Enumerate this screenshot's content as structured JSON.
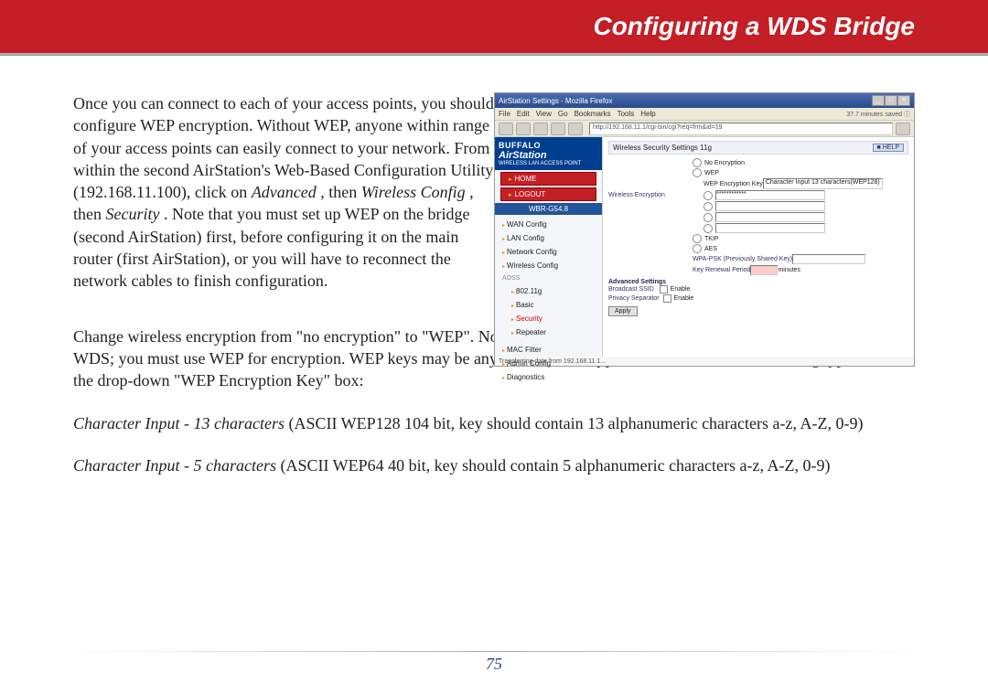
{
  "header": {
    "title": "Configuring a WDS Bridge"
  },
  "body": {
    "p1": "Once you can connect to each of your access points, you should configure WEP encryption. Without WEP, anyone within range of your access points can easily connect to your network.  From within the second AirStation's Web-Based Configuration Utility (192.168.11.100), click on ",
    "p1_i1": "Advanced",
    "p1_a": ", then ",
    "p1_i2": "Wireless Config",
    "p1_b": ", then ",
    "p1_i3": "Security",
    "p1_c": ".  Note that you must set up WEP on the bridge (second AirStation) first, before configuring it on the main router (first AirStation), or you will have to reconnect the network cables to finish configuration.",
    "p2": "Change wireless encryption from \"no encryption\" to \"WEP\".  Note that TKIP and AES encryption schemes will not work with WDS; you must use WEP for encryption.  WEP keys may be any of 4 different types; choose one of the following types from the drop-down \"WEP Encryption Key\" box:",
    "p3_i": "Character Input - 13 characters",
    "p3_r": " (ASCII WEP128 104 bit, key should contain 13 alphanumeric characters a-z, A-Z, 0-9)",
    "p4_i": "Character Input - 5 characters",
    "p4_r": " (ASCII WEP64 40 bit, key should contain 5 alphanumeric characters a-z, A-Z, 0-9)"
  },
  "screenshot": {
    "window_title": "AirStation Settings - Mozilla Firefox",
    "saved": "37.7 minutes saved",
    "menu": [
      "File",
      "Edit",
      "View",
      "Go",
      "Bookmarks",
      "Tools",
      "Help"
    ],
    "url": "http://192.168.11.1/cgi-bin/cgi?req=frm&id=19",
    "logo_top": "BUFFALO",
    "logo_main": "AirStation",
    "logo_sub": "WIRELESS LAN ACCESS POINT",
    "btn_home": "HOME",
    "btn_logout": "LOGOUT",
    "model": "WBR-G54.8",
    "nav": {
      "items": [
        "WAN Config",
        "LAN Config",
        "Network Config",
        "Wireless Config"
      ],
      "group_aoss": "AOSS",
      "sub": [
        "802.11g",
        "Basic",
        "Security",
        "Repeater"
      ],
      "mac": "MAC Filter",
      "admin": [
        "Admin Config",
        "Diagnostics"
      ]
    },
    "panel_title": "Wireless Security Settings 11g",
    "help": "HELP",
    "labels": {
      "wenc": "Wireless Encryption",
      "opt_none": "No Encryption",
      "opt_wep": "WEP",
      "wep_key_label": "WEP Encryption Key",
      "wep_select": "Character Input  13 characters(WEP128)",
      "opt_tkip": "TKIP",
      "opt_aes": "AES",
      "opt_wpa": "WPA-PSK (Previously Shared Key)",
      "re_key": "Key Renewal Period",
      "re_unit": "minutes",
      "adv": "Advanced Settings",
      "bssid": "Broadcast SSID",
      "priv": "Privacy Separator",
      "enable": "Enable",
      "apply": "Apply"
    },
    "status": "Transferring data from 192.168.11.1..."
  },
  "page_number": "75"
}
